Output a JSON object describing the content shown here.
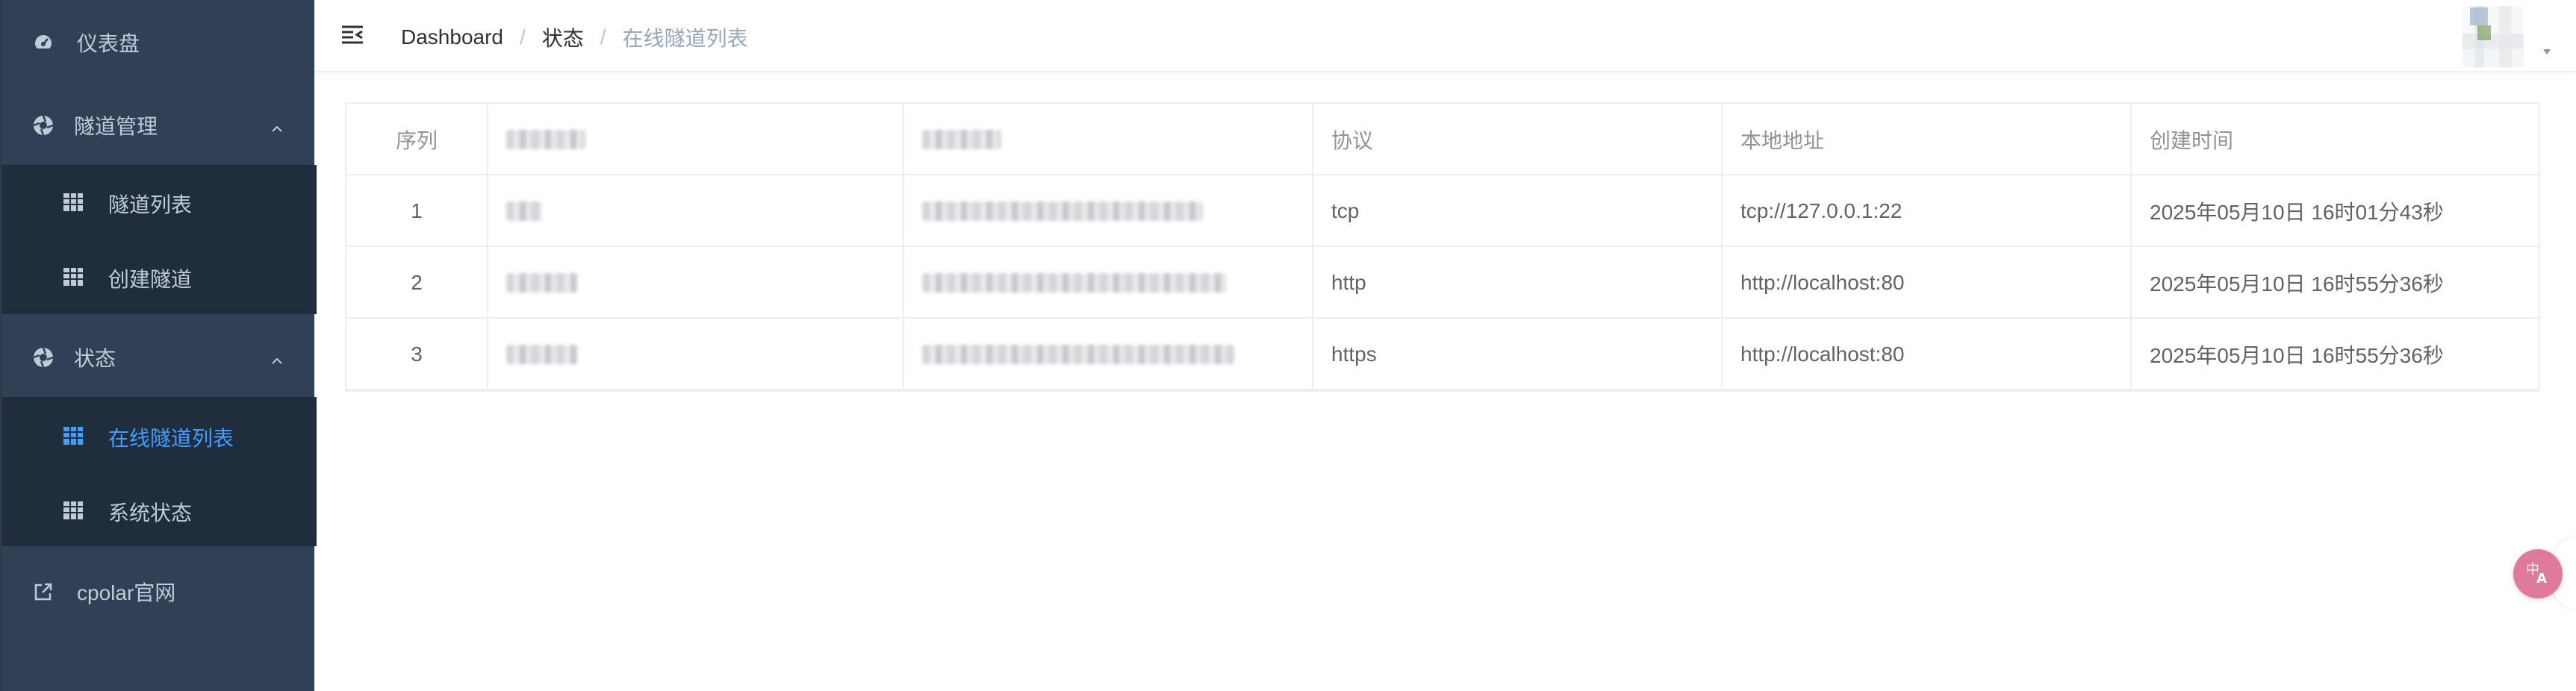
{
  "sidebar": {
    "dashboard": "仪表盘",
    "tunnel_mgmt": "隧道管理",
    "tunnel_list": "隧道列表",
    "create_tunnel": "创建隧道",
    "status": "状态",
    "online_tunnels": "在线隧道列表",
    "system_status": "系统状态",
    "cpolar_site": "cpolar官网"
  },
  "breadcrumb": {
    "home": "Dashboard",
    "section": "状态",
    "current": "在线隧道列表",
    "separator": "/"
  },
  "table": {
    "headers": [
      "序列",
      "",
      "",
      "协议",
      "本地地址",
      "创建时间"
    ],
    "rows": [
      {
        "index": "1",
        "protocol": "tcp",
        "local": "tcp://127.0.0.1:22",
        "created": "2025年05月10日 16时01分43秒"
      },
      {
        "index": "2",
        "protocol": "http",
        "local": "http://localhost:80",
        "created": "2025年05月10日 16时55分36秒"
      },
      {
        "index": "3",
        "protocol": "https",
        "local": "http://localhost:80",
        "created": "2025年05月10日 16时55分36秒"
      }
    ]
  },
  "colors": {
    "sidebar_bg": "#304156",
    "submenu_bg": "#1f2d3d",
    "active": "#409eff",
    "text": "#bfcbd9"
  },
  "icons": {
    "dashboard": "dashboard-icon",
    "tunnel_mgmt": "aperture-icon",
    "list": "grid-table-icon",
    "external": "external-link-icon",
    "hamburger": "menu-fold-icon",
    "translate": "translate-icon"
  }
}
